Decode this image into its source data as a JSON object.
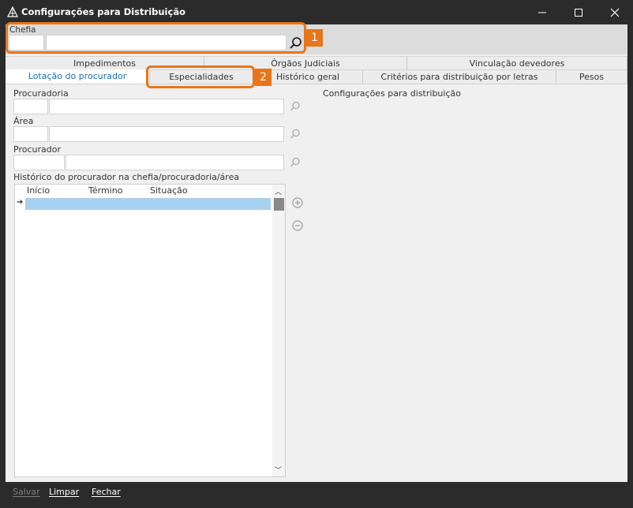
{
  "window": {
    "title": "Configurações para Distribuição"
  },
  "chefia": {
    "label": "Chefia",
    "code_value": "",
    "name_value": ""
  },
  "annotations": [
    {
      "number": "1",
      "target": "Chefia"
    },
    {
      "number": "2",
      "target": "Especialidades"
    }
  ],
  "tabs": {
    "row1": [
      "Impedimentos",
      "Órgãos Judiciais",
      "Vinculação devedores"
    ],
    "row2": [
      "Lotação do procurador",
      "Especialidades",
      "Histórico geral",
      "Critérios para distribuição por letras",
      "Pesos"
    ],
    "active": "Lotação do procurador"
  },
  "lotacao": {
    "procuradoria_label": "Procuradoria",
    "area_label": "Área",
    "procurador_label": "Procurador",
    "historico_label": "Histórico do procurador na chefia/procuradoria/área",
    "config_label": "Configurações para distribuição",
    "grid_columns": [
      "Início",
      "Término",
      "Situação"
    ]
  },
  "footer": {
    "save": "Salvar",
    "clear": "Limpar",
    "close": "Fechar"
  },
  "colors": {
    "highlight": "#e8751a",
    "selected_row": "#a8d0f0",
    "active_tab_text": "#1a6fb5"
  }
}
